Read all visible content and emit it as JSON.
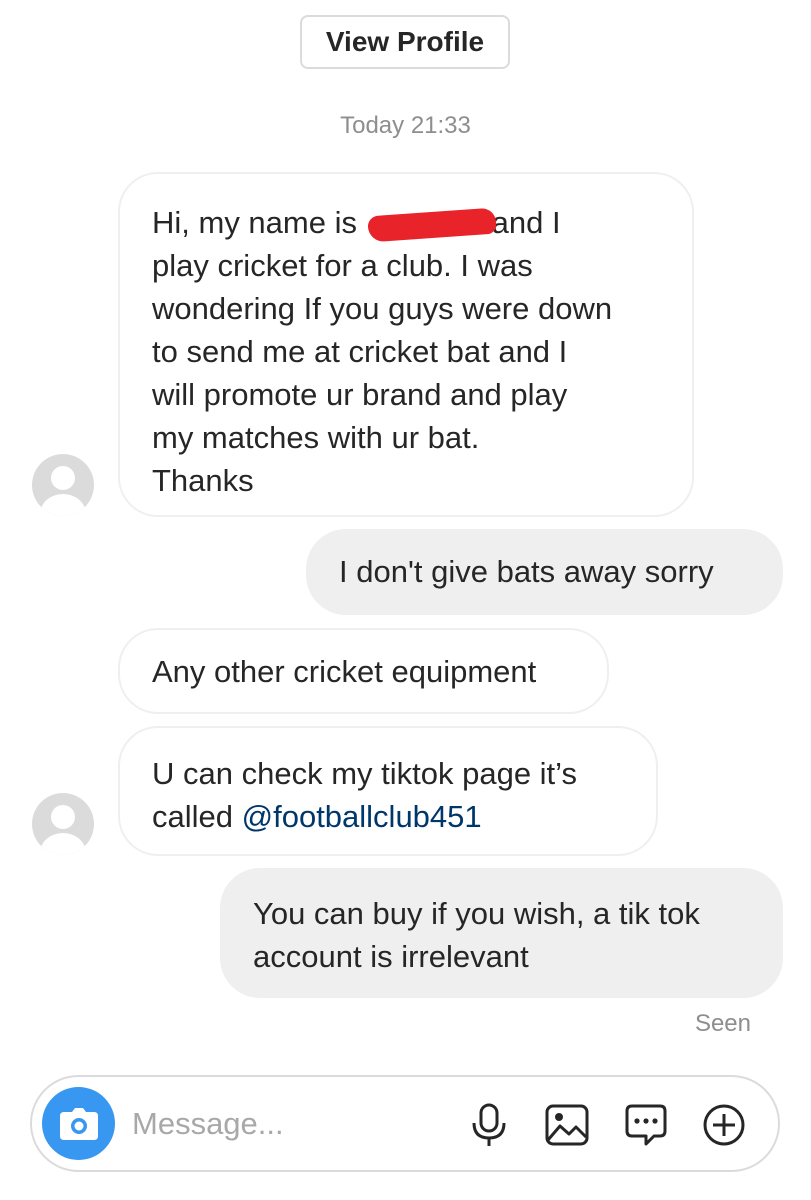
{
  "header": {
    "view_profile_label": "View Profile",
    "timestamp": "Today 21:33"
  },
  "messages": [
    {
      "direction": "incoming",
      "lines": [
        {
          "before": "Hi, my name is",
          "redacted": true,
          "after": "and I"
        },
        "play cricket for a club. I was",
        "wondering If you guys were down",
        "to send me at cricket bat and I",
        "will promote ur brand and play",
        "my matches with ur bat.",
        "Thanks"
      ]
    },
    {
      "direction": "outgoing",
      "lines": [
        "I don't give bats away sorry"
      ]
    },
    {
      "direction": "incoming",
      "lines": [
        "Any other cricket equipment"
      ]
    },
    {
      "direction": "incoming",
      "lines": [
        "U can check my tiktok page it’s"
      ],
      "line2_prefix": "called",
      "mention": "@footballclub451"
    },
    {
      "direction": "outgoing",
      "lines": [
        "You can buy if you wish, a tik tok",
        "account is irrelevant"
      ]
    }
  ],
  "seen_label": "Seen",
  "composer": {
    "placeholder": "Message...",
    "icons": [
      "camera-icon",
      "microphone-icon",
      "gallery-icon",
      "sticker-icon",
      "plus-icon"
    ],
    "accent": "#3897f0"
  },
  "colors": {
    "incoming_bg": "#ffffff",
    "outgoing_bg": "#efefef",
    "mention": "#00376b",
    "redaction": "#e8232a"
  }
}
